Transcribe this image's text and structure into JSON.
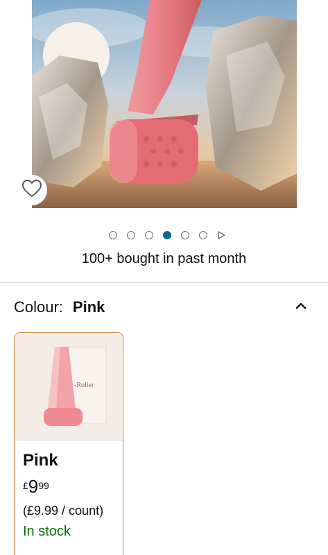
{
  "gallery": {
    "image_count": 6,
    "active_index": 3,
    "has_video": true
  },
  "social_proof": {
    "bought_text": "100+ bought in past month"
  },
  "variation": {
    "label": "Colour:",
    "selected_value": "Pink",
    "options": [
      {
        "name": "Pink",
        "price_symbol": "£",
        "price_whole": "9",
        "price_fraction": "99",
        "unit_price": "(£9.99 / count)",
        "availability": "In stock"
      }
    ]
  },
  "colors": {
    "accent_teal": "#007185",
    "selected_border": "#c7852f",
    "in_stock_green": "#007600",
    "product_pink": "#e97a7f"
  },
  "icons": {
    "wishlist": "heart-outline-icon",
    "collapse": "chevron-up-icon",
    "video": "play-triangle-icon"
  }
}
